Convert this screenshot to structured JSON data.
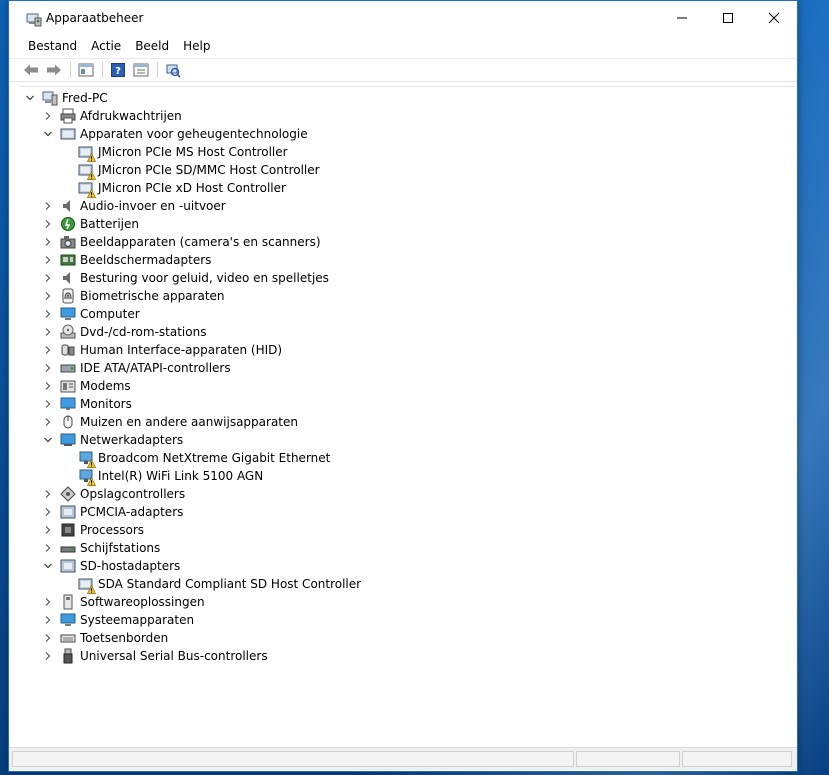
{
  "window": {
    "title": "Apparaatbeheer",
    "minimize_glyph": "—",
    "maximize_glyph": "☐",
    "close_glyph": "✕"
  },
  "menu": [
    "Bestand",
    "Actie",
    "Beeld",
    "Help"
  ],
  "toolbar": [
    "back-arrow-icon",
    "forward-arrow-icon",
    "show-hide-console-tree-icon",
    "help-icon",
    "properties-icon",
    "scan-hardware-icon"
  ],
  "tree": {
    "root": "Fred-PC",
    "items": [
      {
        "label": "Afdrukwachtrijen",
        "icon": "printer-icon",
        "expanded": false
      },
      {
        "label": "Apparaten voor geheugentechnologie",
        "icon": "memory-device-icon",
        "expanded": true,
        "children": [
          {
            "label": "JMicron PCIe MS Host Controller",
            "icon": "controller-warning-icon"
          },
          {
            "label": "JMicron PCIe SD/MMC Host Controller",
            "icon": "controller-warning-icon"
          },
          {
            "label": "JMicron PCIe xD Host Controller",
            "icon": "controller-warning-icon"
          }
        ]
      },
      {
        "label": "Audio-invoer en -uitvoer",
        "icon": "speaker-icon",
        "expanded": false
      },
      {
        "label": "Batterijen",
        "icon": "battery-icon",
        "expanded": false
      },
      {
        "label": "Beeldapparaten (camera's en scanners)",
        "icon": "camera-icon",
        "expanded": false
      },
      {
        "label": "Beeldschermadapters",
        "icon": "display-adapter-icon",
        "expanded": false
      },
      {
        "label": "Besturing voor geluid, video en spelletjes",
        "icon": "speaker-icon",
        "expanded": false
      },
      {
        "label": "Biometrische apparaten",
        "icon": "fingerprint-icon",
        "expanded": false
      },
      {
        "label": "Computer",
        "icon": "computer-icon",
        "expanded": false
      },
      {
        "label": "Dvd-/cd-rom-stations",
        "icon": "disc-drive-icon",
        "expanded": false
      },
      {
        "label": "Human Interface-apparaten (HID)",
        "icon": "hid-icon",
        "expanded": false
      },
      {
        "label": "IDE ATA/ATAPI-controllers",
        "icon": "ide-controller-icon",
        "expanded": false
      },
      {
        "label": "Modems",
        "icon": "modem-icon",
        "expanded": false
      },
      {
        "label": "Monitors",
        "icon": "monitor-icon",
        "expanded": false
      },
      {
        "label": "Muizen en andere aanwijsapparaten",
        "icon": "mouse-icon",
        "expanded": false
      },
      {
        "label": "Netwerkadapters",
        "icon": "network-adapter-icon",
        "expanded": true,
        "children": [
          {
            "label": "Broadcom NetXtreme Gigabit Ethernet",
            "icon": "network-warning-icon"
          },
          {
            "label": "Intel(R) WiFi Link 5100 AGN",
            "icon": "network-warning-icon"
          }
        ]
      },
      {
        "label": "Opslagcontrollers",
        "icon": "storage-controller-icon",
        "expanded": false
      },
      {
        "label": "PCMCIA-adapters",
        "icon": "pcmcia-icon",
        "expanded": false
      },
      {
        "label": "Processors",
        "icon": "processor-icon",
        "expanded": false
      },
      {
        "label": "Schijfstations",
        "icon": "disk-drive-icon",
        "expanded": false
      },
      {
        "label": "SD-hostadapters",
        "icon": "sd-host-icon",
        "expanded": true,
        "children": [
          {
            "label": "SDA Standard Compliant SD Host Controller",
            "icon": "controller-warning-icon"
          }
        ]
      },
      {
        "label": "Softwareoplossingen",
        "icon": "software-icon",
        "expanded": false
      },
      {
        "label": "Systeemapparaten",
        "icon": "system-device-icon",
        "expanded": false
      },
      {
        "label": "Toetsenborden",
        "icon": "keyboard-icon",
        "expanded": false
      },
      {
        "label": "Universal Serial Bus-controllers",
        "icon": "usb-icon",
        "expanded": false
      }
    ]
  }
}
